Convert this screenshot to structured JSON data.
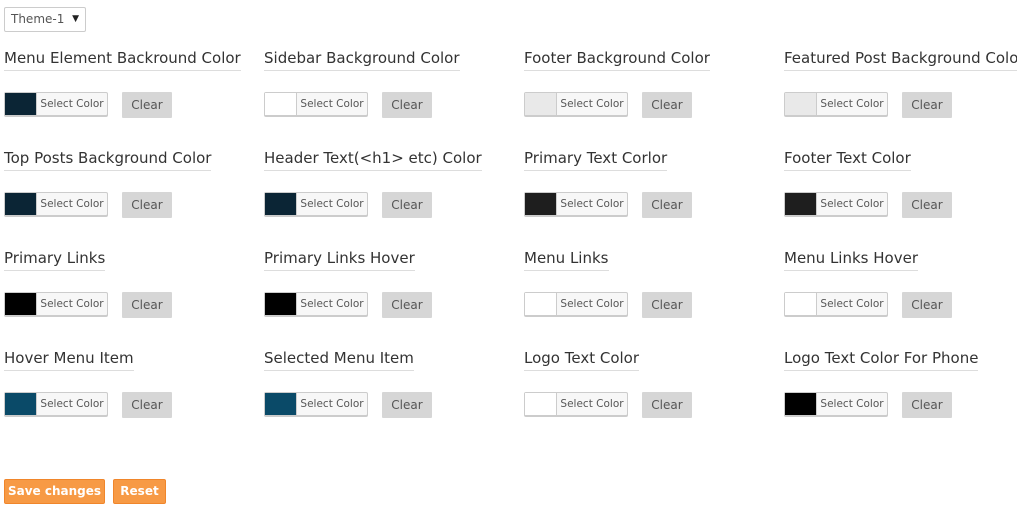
{
  "theme_selector": {
    "value": "Theme-1"
  },
  "settings": [
    {
      "label": "Menu Element Backround Color",
      "swatch": "#0b2535",
      "select_label": "Select Color",
      "clear_label": "Clear"
    },
    {
      "label": "Sidebar Background Color",
      "swatch": "#ffffff",
      "select_label": "Select Color",
      "clear_label": "Clear"
    },
    {
      "label": "Footer Background Color",
      "swatch": "#e9e9e9",
      "select_label": "Select Color",
      "clear_label": "Clear"
    },
    {
      "label": "Featured Post Background Color",
      "swatch": "#e9e9e9",
      "select_label": "Select Color",
      "clear_label": "Clear"
    },
    {
      "label": "Top Posts Background Color",
      "swatch": "#0b2535",
      "select_label": "Select Color",
      "clear_label": "Clear"
    },
    {
      "label": "Header Text(<h1> etc) Color",
      "swatch": "#0b2535",
      "select_label": "Select Color",
      "clear_label": "Clear"
    },
    {
      "label": "Primary Text Corlor",
      "swatch": "#1e1e1e",
      "select_label": "Select Color",
      "clear_label": "Clear"
    },
    {
      "label": "Footer Text Color",
      "swatch": "#1e1e1e",
      "select_label": "Select Color",
      "clear_label": "Clear"
    },
    {
      "label": "Primary Links",
      "swatch": "#000000",
      "select_label": "Select Color",
      "clear_label": "Clear"
    },
    {
      "label": "Primary Links Hover",
      "swatch": "#000000",
      "select_label": "Select Color",
      "clear_label": "Clear"
    },
    {
      "label": "Menu Links",
      "swatch": "#ffffff",
      "select_label": "Select Color",
      "clear_label": "Clear"
    },
    {
      "label": "Menu Links Hover",
      "swatch": "#ffffff",
      "select_label": "Select Color",
      "clear_label": "Clear"
    },
    {
      "label": "Hover Menu Item",
      "swatch": "#0a4a68",
      "select_label": "Select Color",
      "clear_label": "Clear"
    },
    {
      "label": "Selected Menu Item",
      "swatch": "#0a4a68",
      "select_label": "Select Color",
      "clear_label": "Clear"
    },
    {
      "label": "Logo Text Color",
      "swatch": "#ffffff",
      "select_label": "Select Color",
      "clear_label": "Clear"
    },
    {
      "label": "Logo Text Color For Phone",
      "swatch": "#000000",
      "select_label": "Select Color",
      "clear_label": "Clear"
    }
  ],
  "actions": {
    "save_label": "Save changes",
    "reset_label": "Reset"
  },
  "colors": {
    "accent": "#f79a45",
    "clear_bg": "#d6d6d6"
  }
}
